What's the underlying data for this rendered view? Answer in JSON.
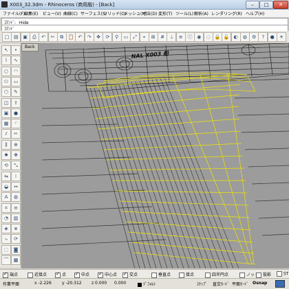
{
  "window": {
    "title": "X003_32.3dm - Rhinoceros (商用版) - [Back]",
    "controls": [
      "–",
      "□",
      "✕"
    ]
  },
  "menubar": {
    "items": [
      "ファイル(F)",
      "編集(E)",
      "ビュー(V)",
      "曲線(C)",
      "サーフェス(S)",
      "ソリッド(O)",
      "メッシュ(M)",
      "寸法(D)",
      "変形(T)",
      "ツール(L)",
      "解析(A)",
      "レンダリング(R)",
      "ヘルプ(H)"
    ]
  },
  "command": {
    "history": "ｺﾏﾝﾄﾞ: _Hide",
    "prompt": "ｺﾏﾝﾄﾞ"
  },
  "toolbar": {
    "icons": [
      "new-file-icon",
      "open-icon",
      "save-icon",
      "print-icon",
      "undo-icon",
      "cut-icon",
      "copy-icon",
      "paste-icon",
      "undo-arrow-icon",
      "redo-arrow-icon",
      "pan-icon",
      "rotate-view-icon",
      "zoom-icon",
      "zoom-window-icon",
      "zoom-extents-icon",
      "zoom-selected-icon",
      "four-view-icon",
      "grid-icon",
      "cplane-icon",
      "layers-icon",
      "properties-icon",
      "show-icon",
      "hide-icon",
      "lock-icon",
      "unlock-icon",
      "shade-icon",
      "render-icon",
      "options-icon",
      "help-icon",
      "material-icon",
      "light-icon"
    ]
  },
  "viewport": {
    "label": "Back",
    "model_text": "NAL X003 船"
  },
  "osnap": {
    "items": [
      {
        "label": "端点",
        "checked": true
      },
      {
        "label": "近接点",
        "checked": false
      },
      {
        "label": "点",
        "checked": true
      },
      {
        "label": "中点",
        "checked": true
      },
      {
        "label": "中心点",
        "checked": true
      },
      {
        "label": "交点",
        "checked": true
      },
      {
        "label": "垂直点",
        "checked": false
      },
      {
        "label": "接点",
        "checked": false
      },
      {
        "label": "四半円点",
        "checked": false
      },
      {
        "label": "ノット",
        "checked": false
      },
      {
        "label": "投影",
        "checked": false
      },
      {
        "label": "ST",
        "checked": false
      }
    ]
  },
  "status": {
    "cplane": "作業平面",
    "x": "x -2.226",
    "y": "y -20.312",
    "z": "z 0.000",
    "dist": "0.000",
    "layer": "ﾃﾞﾌｫﾙﾄ",
    "snap": "ｽﾅｯﾌﾟ",
    "ortho": "直交ﾓｰﾄﾞ",
    "planar": "平面ﾓｰﾄﾞ",
    "osnap": "Osnap"
  },
  "colors": {
    "wireframe_dark": "#141414",
    "wireframe_selected": "#f2e600",
    "viewport_bg": "#9c9c9c"
  }
}
